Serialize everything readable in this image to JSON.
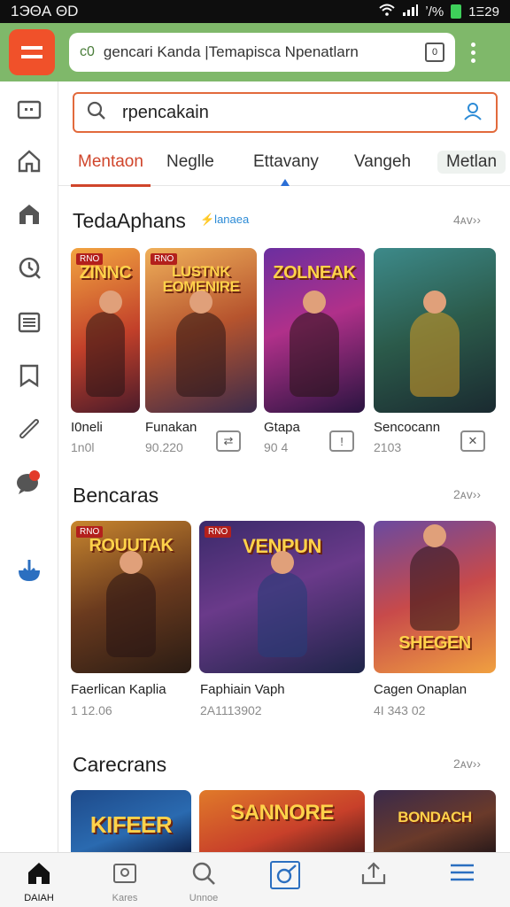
{
  "status_bar": {
    "left_text": "1ЭΘА ΘD",
    "time": "1Ξ29",
    "signal_text": "ʼ/%"
  },
  "browser": {
    "url_prefix": "c0",
    "url_text": "gencari Kanda |Temapisca Npenatlarn",
    "tab_count": "0"
  },
  "left_rail": {
    "icons": [
      "screen-icon",
      "home-icon",
      "store-icon",
      "clock-icon",
      "list-icon",
      "bookmark-icon",
      "link-icon",
      "chat-icon",
      "download-icon"
    ]
  },
  "search": {
    "value": "rpencakain"
  },
  "category_tabs": [
    {
      "label": "Mentaon",
      "active": true
    },
    {
      "label": "Neglle",
      "active": false
    },
    {
      "label": "Ettavany",
      "active": false
    },
    {
      "label": "Vangeh",
      "active": false
    },
    {
      "label": "Metlan",
      "active": false
    }
  ],
  "sections": [
    {
      "title": "TedaAphans",
      "badge": "⚡lanaea",
      "more": "4ᴀᴠ››",
      "items": [
        {
          "art": "ZINNC",
          "tag": "RNO",
          "name": "I0neli",
          "meta": "1n0l",
          "action": ""
        },
        {
          "art": "LUSTNK EOMENIRE",
          "tag": "RNO",
          "name": "Funakan",
          "meta": "90.220",
          "action": "⇄"
        },
        {
          "art": "ZOLNEAK",
          "tag": "",
          "name": "Gtapa",
          "meta": "90 4",
          "action": "!"
        },
        {
          "art": "",
          "tag": "",
          "name": "Sencocann",
          "meta": "2103",
          "action": "✕"
        }
      ]
    },
    {
      "title": "Bencaras",
      "badge": "",
      "more": "2ᴀᴠ››",
      "items": [
        {
          "art": "ROUUTAK",
          "tag": "RNO",
          "name": "Faerlican Kaplia",
          "meta": "1 12.06"
        },
        {
          "art": "VENPUN",
          "tag": "RNO",
          "name": "Faphiain Vaph",
          "meta": "2A1113902"
        },
        {
          "art": "SHEGEN",
          "tag": "",
          "name": "Cagen Onaplan",
          "meta": "4I 343 02"
        }
      ]
    },
    {
      "title": "Carecrans",
      "badge": "",
      "more": "2ᴀᴠ››",
      "items": [
        {
          "art": "KIFEER"
        },
        {
          "art": "SANNORE"
        },
        {
          "art": "BONDACH"
        }
      ]
    }
  ],
  "bottom_nav": [
    {
      "label": "DΑΙΑΗ",
      "icon": "home-icon",
      "active": true
    },
    {
      "label": "Kares",
      "icon": "map-icon",
      "active": false
    },
    {
      "label": "Unnoe",
      "icon": "search-icon",
      "active": false
    },
    {
      "label": "",
      "icon": "gamepad-icon",
      "active": false
    },
    {
      "label": "",
      "icon": "share-icon",
      "active": false
    },
    {
      "label": "",
      "icon": "menu-icon",
      "active": false
    }
  ]
}
